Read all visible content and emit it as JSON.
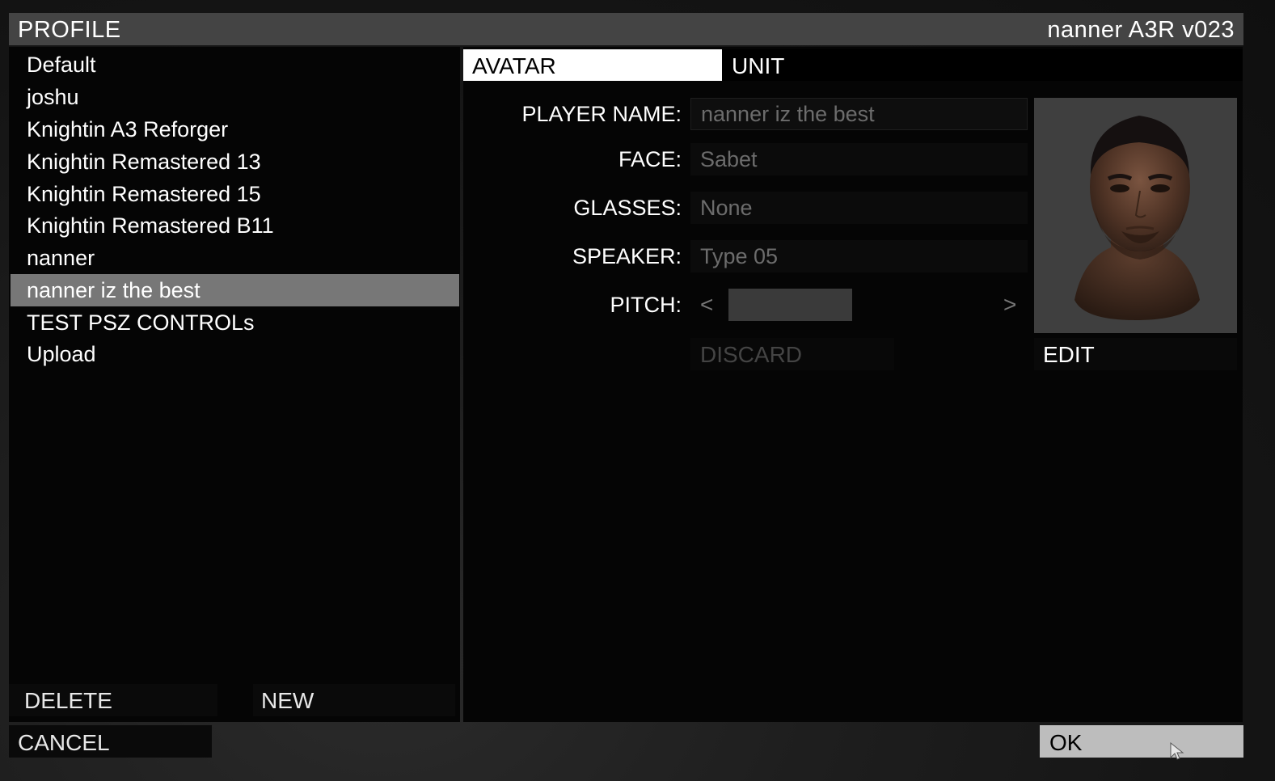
{
  "header": {
    "title": "PROFILE",
    "version": "nanner A3R v023"
  },
  "profiles": {
    "items": [
      "Default",
      "joshu",
      "Knightin A3 Reforger",
      "Knightin Remastered 13",
      "Knightin Remastered 15",
      "Knightin Remastered B11",
      "nanner",
      "nanner iz the best",
      "TEST PSZ CONTROLs",
      "Upload"
    ],
    "selected_index": 7,
    "delete_label": "DELETE",
    "new_label": "NEW"
  },
  "tabs": {
    "avatar": "AVATAR",
    "unit": "UNIT",
    "active": "AVATAR"
  },
  "form": {
    "player_name_label": "PLAYER NAME:",
    "player_name_value": "nanner iz the best",
    "face_label": "FACE:",
    "face_value": "Sabet",
    "glasses_label": "GLASSES:",
    "glasses_value": "None",
    "speaker_label": "SPEAKER:",
    "speaker_value": "Type 05",
    "pitch_label": "PITCH:",
    "pitch_prev": "<",
    "pitch_next": ">",
    "discard_label": "DISCARD",
    "edit_label": "EDIT"
  },
  "footer": {
    "cancel_label": "CANCEL",
    "ok_label": "OK"
  },
  "colors": {
    "titlebar": "#444444",
    "selected_row": "#777777",
    "active_tab": "#ffffff",
    "ok_button": "#bdbdbd",
    "muted_text": "#6c6c6c"
  },
  "icons": {
    "portrait": "face-portrait",
    "cursor": "mouse-pointer-icon"
  }
}
